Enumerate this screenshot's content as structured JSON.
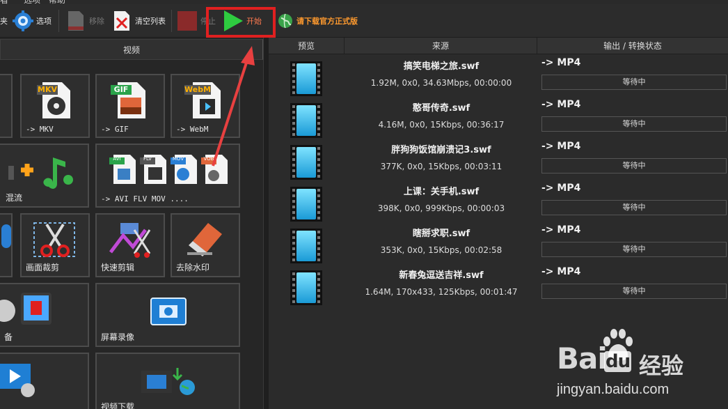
{
  "menubar": {
    "items": [
      "看",
      "选项",
      "帮助"
    ]
  },
  "toolbar": {
    "favorites": "夹",
    "options": "选项",
    "remove": "移除",
    "clear_list": "清空列表",
    "stop": "停止",
    "start": "开始",
    "download": "请下载官方正式版"
  },
  "left_panel": {
    "header": "视频",
    "tiles": {
      "mkv": {
        "badge": "MKV",
        "label": "-> MKV"
      },
      "gif": {
        "badge": "GIF",
        "label": "-> GIF"
      },
      "webm": {
        "badge": "WebM",
        "label": "-> WebM"
      },
      "mix": {
        "label": "混流"
      },
      "multi": {
        "badges": [
          "AVI",
          "FLV",
          "MOV",
          "VOB"
        ],
        "label": "-> AVI FLV MOV ...."
      },
      "crop": {
        "label": "画面裁剪"
      },
      "quick_cut": {
        "label": "快速剪辑"
      },
      "watermark": {
        "label": "去除水印"
      },
      "device": {
        "label": "备"
      },
      "screen_record": {
        "label": "屏幕录像"
      },
      "video_download": {
        "label": "视频下载"
      }
    }
  },
  "file_list": {
    "columns": {
      "preview": "预览",
      "source": "来源",
      "output": "输出 / 转换状态"
    },
    "rows": [
      {
        "name": "搞笑电梯之旅.swf",
        "info": "1.92M, 0x0, 34.63Mbps, 00:00:00",
        "format": "-> MP4",
        "status": "等待中"
      },
      {
        "name": "憨哥传奇.swf",
        "info": "4.16M, 0x0, 15Kbps, 00:36:17",
        "format": "-> MP4",
        "status": "等待中"
      },
      {
        "name": "胖狗狗饭馆崩溃记3.swf",
        "info": "377K, 0x0, 15Kbps, 00:03:11",
        "format": "-> MP4",
        "status": "等待中"
      },
      {
        "name": "上课：关手机.swf",
        "info": "398K, 0x0, 999Kbps, 00:00:03",
        "format": "-> MP4",
        "status": "等待中"
      },
      {
        "name": "瞎掰求职.swf",
        "info": "353K, 0x0, 15Kbps, 00:02:58",
        "format": "-> MP4",
        "status": "等待中"
      },
      {
        "name": "新春兔逗送吉祥.swf",
        "info": "1.64M, 170x433, 125Kbps, 00:01:47",
        "format": "-> MP4",
        "status": "等待中"
      }
    ]
  },
  "watermark": {
    "brand_a": "Bai",
    "brand_b": "du",
    "brand_c": "经验",
    "url": "jingyan.baidu.com"
  },
  "colors": {
    "accent_red": "#e02020",
    "start_green": "#2ecc40",
    "download_orange": "#ff9a2e"
  }
}
